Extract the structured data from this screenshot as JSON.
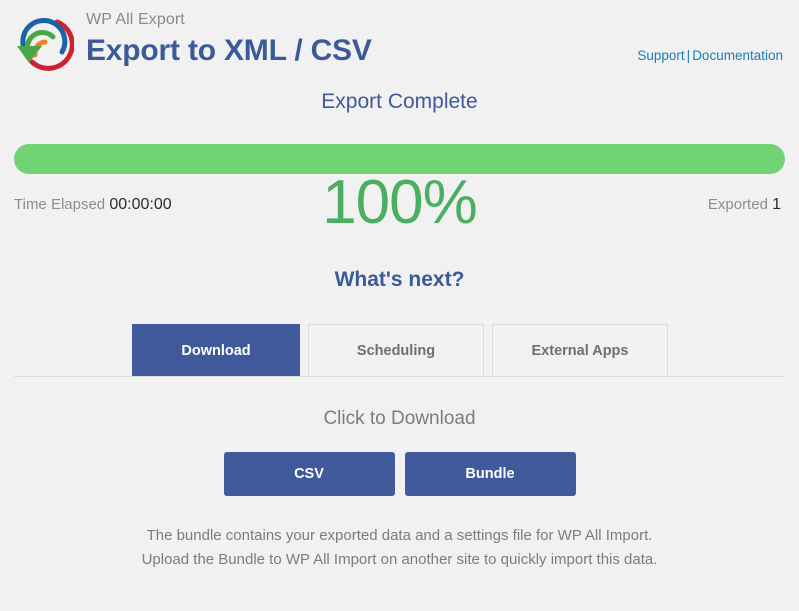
{
  "header": {
    "logo_icon": "wp-all-export-circular-arrow-logo",
    "brand_subtitle": "WP All Export",
    "brand_title": "Export to XML / CSV",
    "links": {
      "support": "Support",
      "separator": "|",
      "documentation": "Documentation"
    }
  },
  "status": {
    "title": "Export Complete",
    "progress_percent": 100,
    "progress_label": "100%",
    "progress_color": "#71d372",
    "time_elapsed_label": "Time Elapsed",
    "time_elapsed_value": "00:00:00",
    "exported_label": "Exported",
    "exported_value": "1"
  },
  "next_steps": {
    "heading": "What's next?",
    "tabs": [
      {
        "label": "Download",
        "active": true
      },
      {
        "label": "Scheduling",
        "active": false
      },
      {
        "label": "External Apps",
        "active": false
      }
    ]
  },
  "download_panel": {
    "heading": "Click to Download",
    "buttons": [
      {
        "label": "CSV"
      },
      {
        "label": "Bundle"
      }
    ],
    "note_line1": "The bundle contains your exported data and a settings file for WP All Import.",
    "note_line2": "Upload the Bundle to WP All Import on another site to quickly import this data."
  },
  "colors": {
    "brand_blue": "#3d5a98",
    "link_blue": "#1a7cb8",
    "success_green": "#4cae62",
    "progress_green": "#71d372",
    "page_background": "#f1f1f1"
  }
}
